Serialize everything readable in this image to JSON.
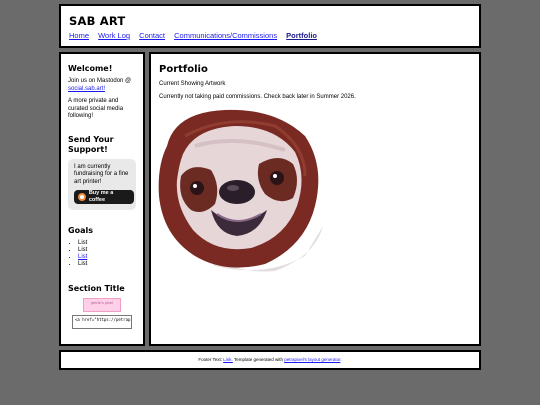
{
  "header": {
    "title": "SAB ART",
    "nav": [
      "Home",
      "Work Log",
      "Contact",
      "Communications/Commissions",
      "Portfolio"
    ],
    "active": "Portfolio"
  },
  "sidebar": {
    "welcome": {
      "heading": "Welcome!",
      "mastodon_prefix": "Join us on Mastodon @",
      "mastodon_link": "social.sab.art!",
      "text": "A more private and curated social media following!"
    },
    "support": {
      "heading": "Send Your Support!",
      "text": "I am currently fundraising for a fine art printer!",
      "button_label": "Buy me a coffee"
    },
    "goals": {
      "heading": "Goals",
      "items": [
        "List",
        "List",
        "List",
        "List"
      ]
    },
    "section": {
      "heading": "Section Title",
      "badge": "petrie's pixel",
      "code": "<a href=\"https://petrapix"
    }
  },
  "main": {
    "title": "Portfolio",
    "subtitle": "Current Showing Artwork",
    "notice": "Currently not taking paid commissions. Check back later in Summer 2026."
  },
  "footer": {
    "prefix": "Footer Text: ",
    "link1": "Link.",
    "middle": " Template generated with ",
    "link2": "petrapixel's layout generator",
    "suffix": "."
  },
  "colors": {
    "page_bg": "#6b6b6b",
    "link": "#1a1aee",
    "sloth_fur": "#7a2a22",
    "sloth_face": "#e6d6d8"
  }
}
